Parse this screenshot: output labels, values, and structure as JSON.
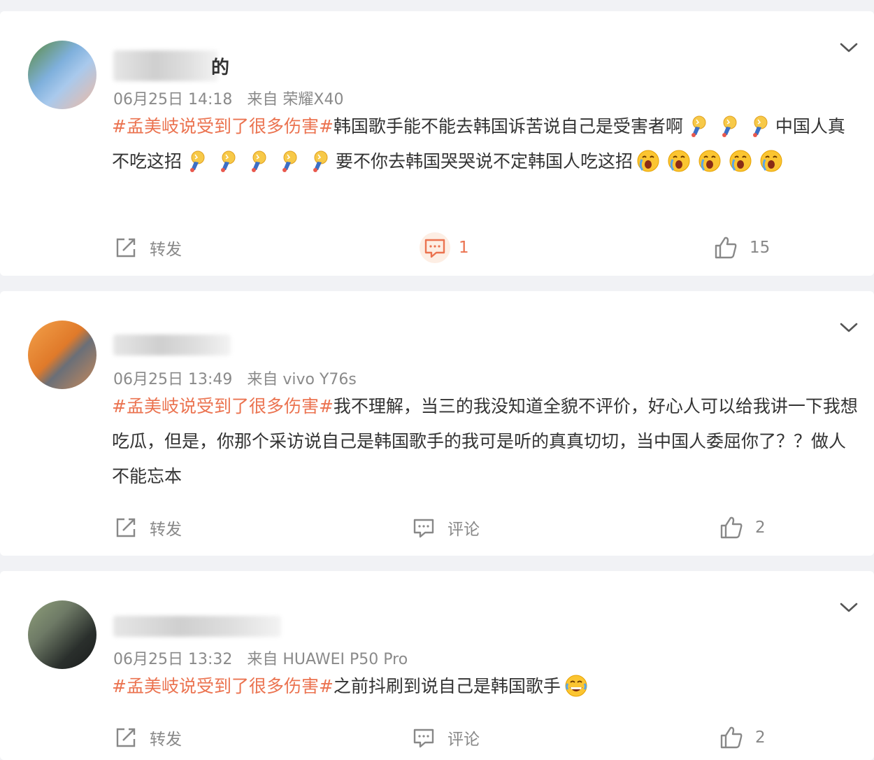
{
  "posts": [
    {
      "name_tail": "的",
      "date": "06月25日 14:18",
      "source": "来自 荣耀X40",
      "hashtag": "#孟美岐说受到了很多伤害#",
      "text_a": "韩国歌手能不能去韩国诉苦说自己是受害者啊",
      "text_b": "中国人真不吃这招",
      "text_c": "要不你去韩国哭哭说不定韩国人吃这招",
      "repost_label": "转发",
      "comment_count": "1",
      "like_count": "15"
    },
    {
      "date": "06月25日 13:49",
      "source": "来自 vivo Y76s",
      "hashtag": "#孟美岐说受到了很多伤害#",
      "text": "我不理解，当三的我没知道全貌不评价，好心人可以给我讲一下我想吃瓜，但是，你那个采访说自己是韩国歌手的我可是听的真真切切，当中国人委屈你了？？做人不能忘本",
      "repost_label": "转发",
      "comment_label": "评论",
      "like_count": "2"
    },
    {
      "date": "06月25日 13:32",
      "source": "来自 HUAWEI P50 Pro",
      "hashtag": "#孟美岐说受到了很多伤害#",
      "text": "之前抖刷到说自己是韩国歌手",
      "repost_label": "转发",
      "comment_label": "评论",
      "like_count": "2"
    }
  ],
  "colors": {
    "hashtag": "#eb7350",
    "meta": "#8a8a8a",
    "action": "#888888",
    "background": "#f1f2f5"
  },
  "icons": [
    "chevron-down-icon",
    "repost-icon",
    "comment-icon",
    "like-icon",
    "lightbulb-emoji-icon",
    "crying-emoji-icon",
    "laugh-tears-emoji-icon"
  ]
}
